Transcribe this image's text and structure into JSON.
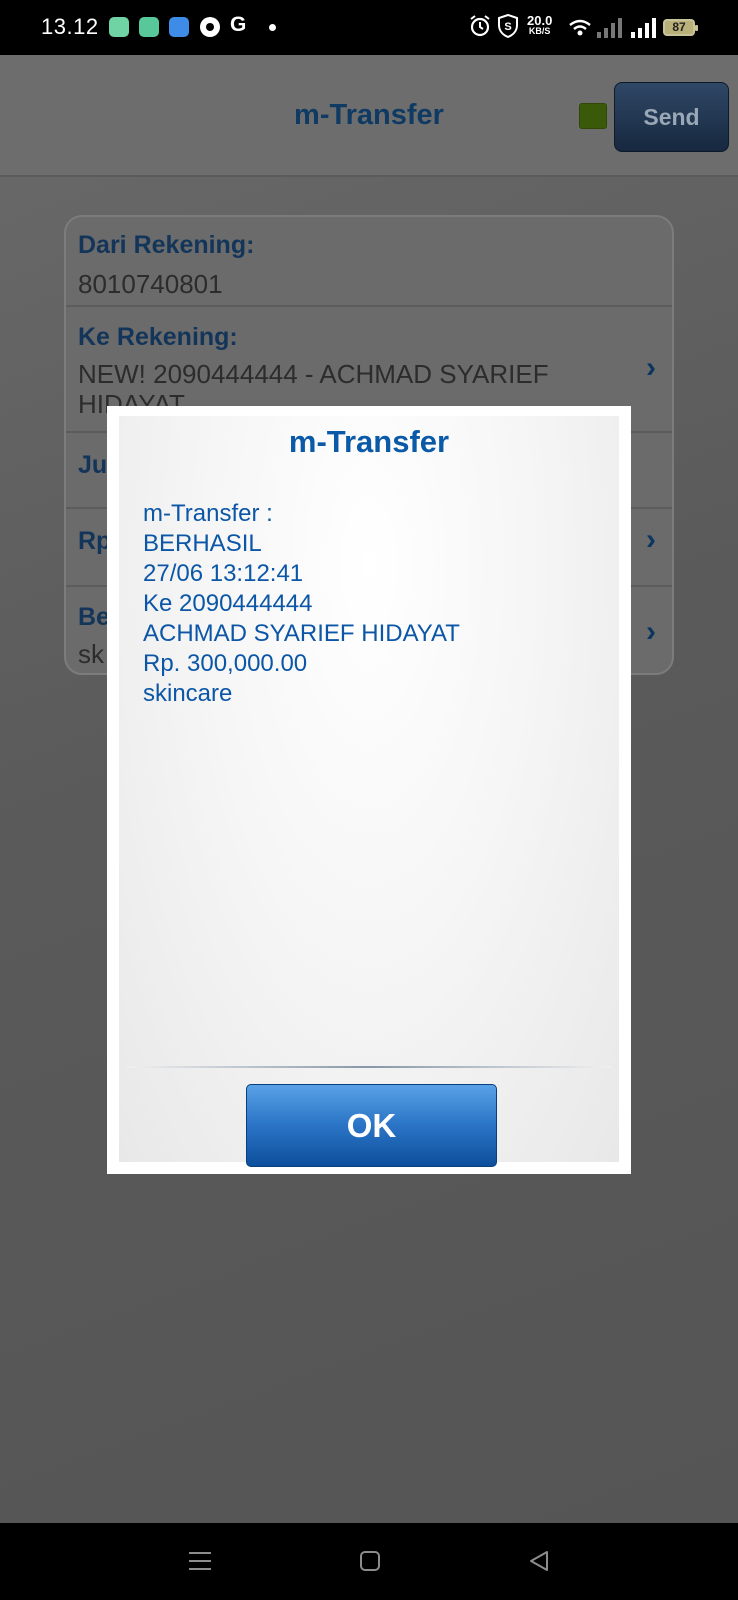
{
  "status_bar": {
    "time": "13.12",
    "speed_value": "20.0",
    "speed_unit": "KB/S",
    "battery": "87",
    "icons": [
      "app-icon-1",
      "app-icon-2",
      "app-icon-3",
      "app-icon-4",
      "google-icon",
      "alarm-icon",
      "shield-s-icon",
      "wifi-icon",
      "signal-icon",
      "signal-icon",
      "battery-icon"
    ]
  },
  "header": {
    "title": "m-Transfer",
    "send_label": "Send"
  },
  "form": {
    "from_label": "Dari Rekening:",
    "from_value": "8010740801",
    "to_label": "Ke Rekening:",
    "to_value": "NEW! 2090444444 - ACHMAD SYARIEF HIDAYAT",
    "amount_label_fragment": "Ju",
    "currency_fragment": "Rp",
    "note_label_fragment": "Be",
    "note_value_fragment": "sk"
  },
  "dialog": {
    "title": "m-Transfer",
    "message_lines": [
      "m-Transfer :",
      "BERHASIL",
      "27/06 13:12:41",
      "Ke 2090444444",
      "ACHMAD SYARIEF HIDAYAT",
      "Rp. 300,000.00",
      "skincare"
    ],
    "ok_label": "OK"
  },
  "colors": {
    "dialog_text": "#0b56a6",
    "ok_button": "#2e78c9",
    "header_title": "#0e3a63",
    "status_indicator": "#3a5a0a"
  }
}
